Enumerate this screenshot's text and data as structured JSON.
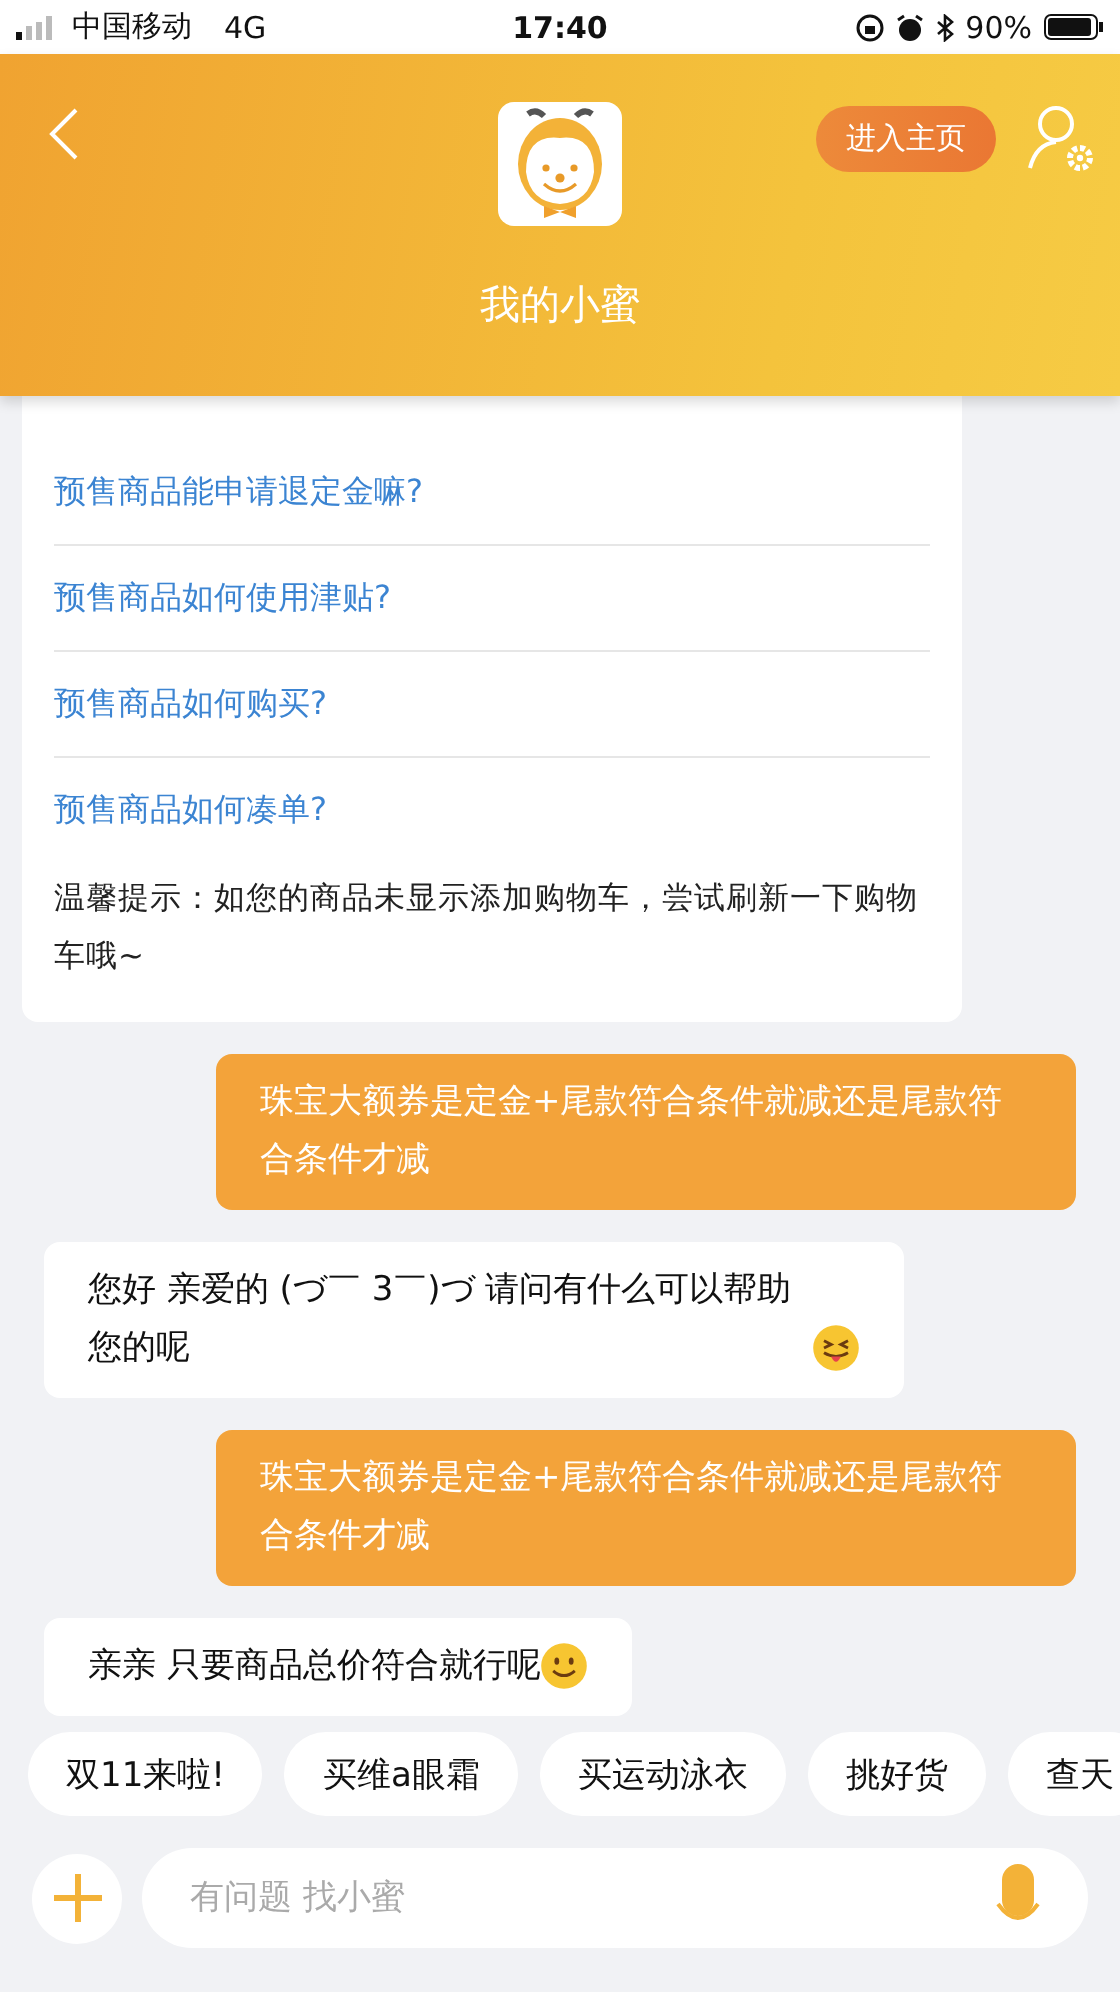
{
  "status_bar": {
    "carrier": "中国移动",
    "network": "4G",
    "time": "17:40",
    "battery": "90%"
  },
  "header": {
    "home_button": "进入主页",
    "title": "我的小蜜"
  },
  "faq_card": {
    "questions": [
      "预售商品能申请退定金嘛?",
      "预售商品如何使用津贴?",
      "预售商品如何购买?",
      "预售商品如何凑单?"
    ],
    "tip": "温馨提示：如您的商品未显示添加购物车，尝试刷新一下购物车哦~"
  },
  "messages": [
    {
      "kind": "user",
      "text": "珠宝大额券是定金+尾款符合条件就减还是尾款符合条件才减"
    },
    {
      "kind": "bot",
      "text": "您好 亲爱的 (づ￣ 3￣)づ 请问有什么可以帮助您的呢",
      "emoji": {
        "kind": "tongue"
      }
    },
    {
      "kind": "user",
      "text": "珠宝大额券是定金+尾款符合条件就减还是尾款符合条件才减"
    },
    {
      "kind": "bot",
      "text": "亲亲 只要商品总价符合就行呢",
      "emoji": {
        "kind": "smile"
      }
    }
  ],
  "quick_replies": [
    "双11来啦!",
    "买维a眼霜",
    "买运动泳衣",
    "挑好货",
    "查天"
  ],
  "input": {
    "placeholder": "有问题 找小蜜"
  }
}
